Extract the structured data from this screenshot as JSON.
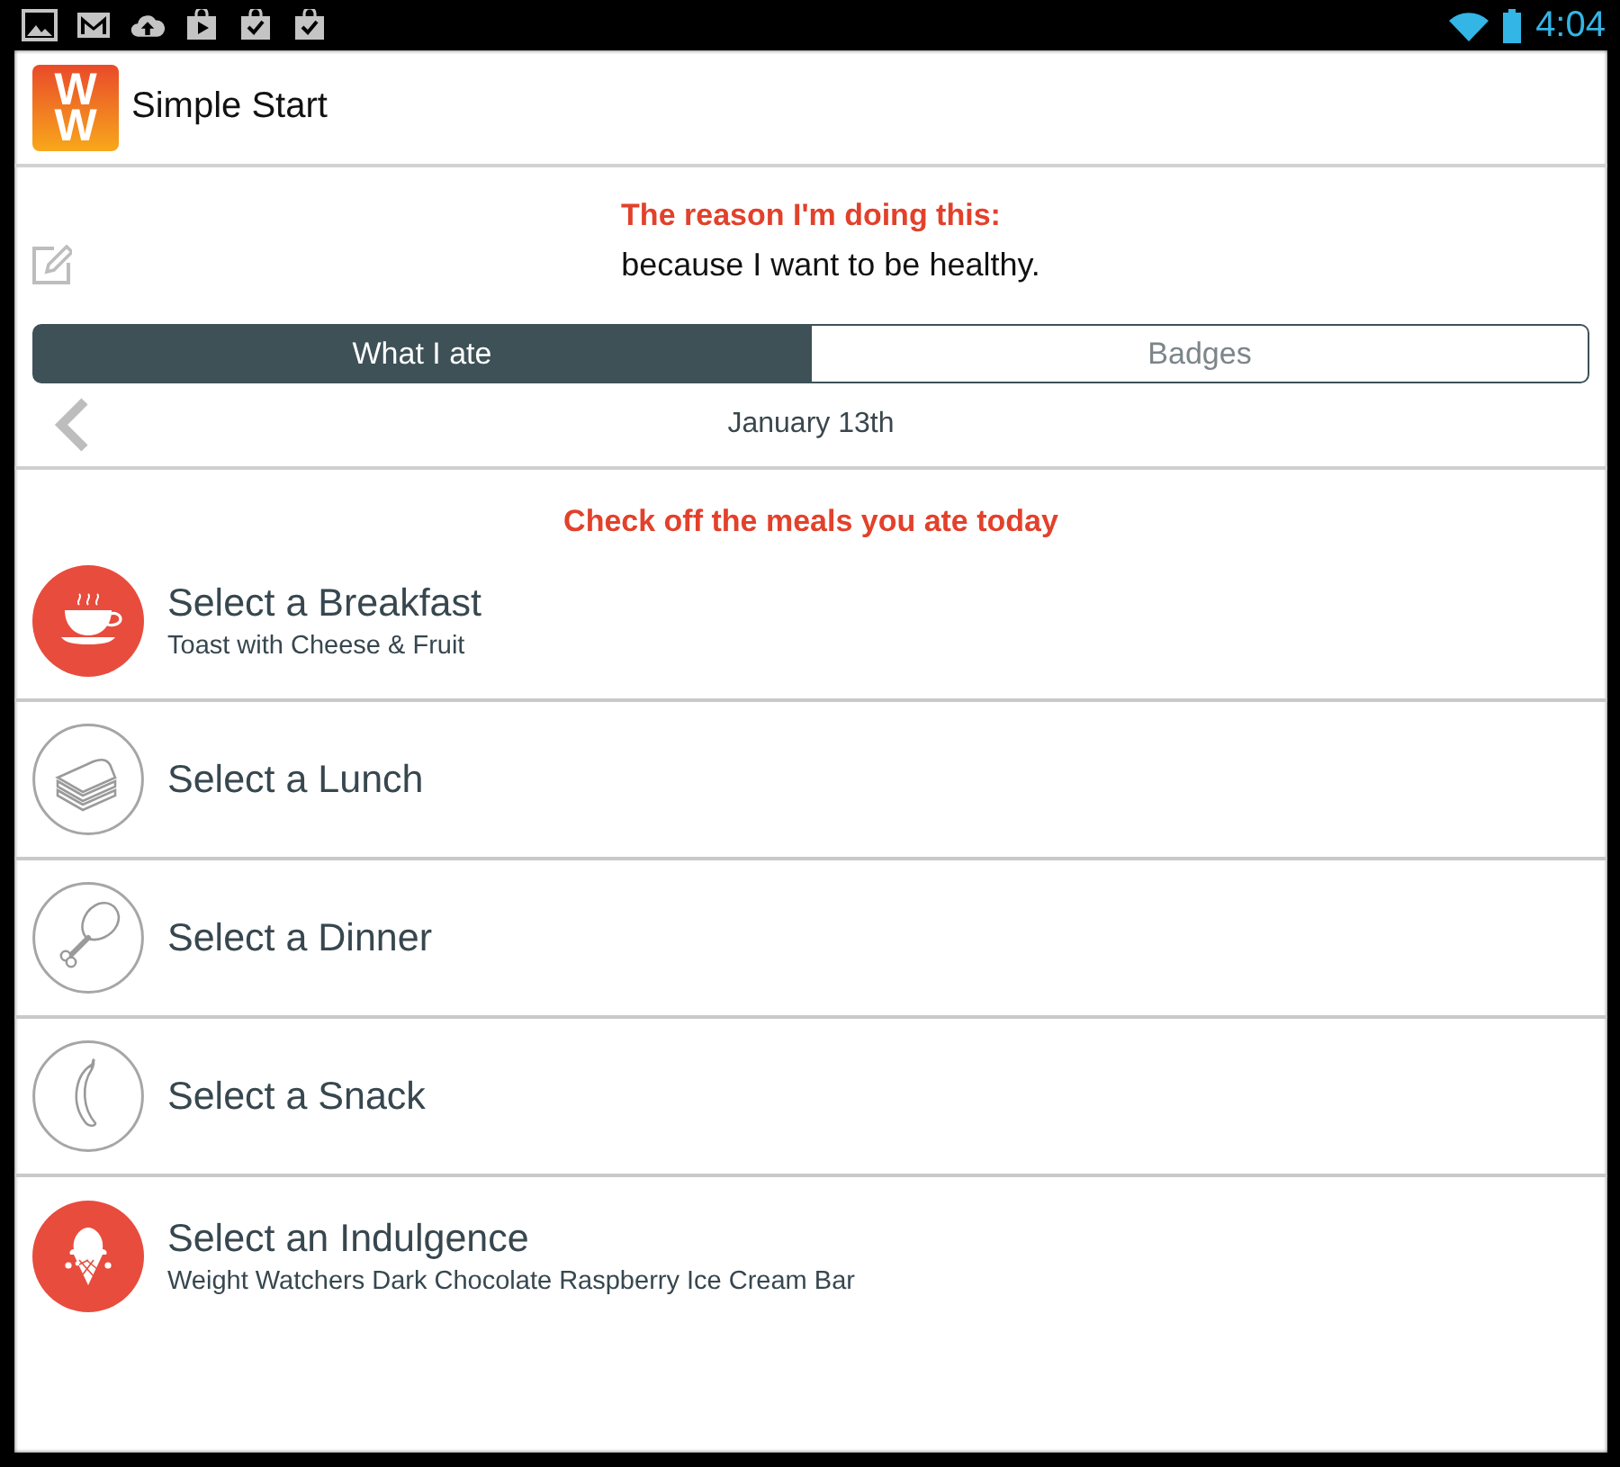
{
  "status_bar": {
    "time": "4:04"
  },
  "app_bar": {
    "logo": "WW",
    "title": "Simple Start"
  },
  "reason": {
    "heading": "The reason I'm doing this:",
    "text": "because I want to be healthy."
  },
  "tabs": [
    {
      "label": "What I ate",
      "selected": true
    },
    {
      "label": "Badges",
      "selected": false
    }
  ],
  "date_nav": {
    "date": "January 13th"
  },
  "meals": {
    "heading": "Check off the meals you ate today",
    "items": [
      {
        "title": "Select a Breakfast",
        "subtitle": "Toast with Cheese & Fruit",
        "checked": true
      },
      {
        "title": "Select a Lunch",
        "checked": false
      },
      {
        "title": "Select a Dinner",
        "checked": false
      },
      {
        "title": "Select a Snack",
        "checked": false
      },
      {
        "title": "Select an Indulgence",
        "subtitle": "Weight Watchers Dark Chocolate Raspberry Ice Cream Bar",
        "checked": true
      }
    ]
  }
}
